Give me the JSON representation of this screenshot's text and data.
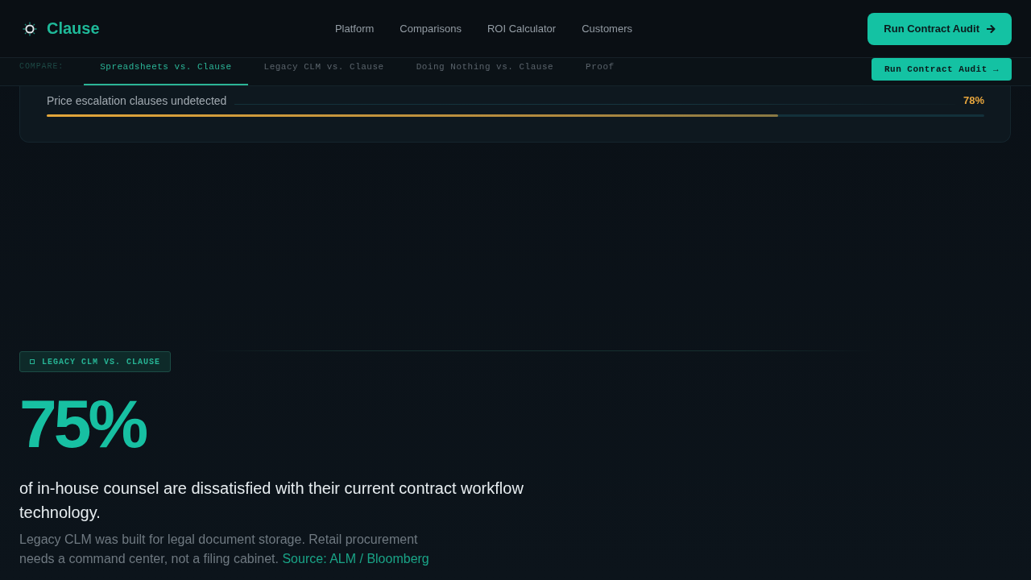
{
  "header": {
    "brand": "Clause",
    "nav": [
      "Platform",
      "Comparisons",
      "ROI Calculator",
      "Customers"
    ],
    "cta": "Run Contract Audit"
  },
  "compare_bar": {
    "label": "COMPARE:",
    "tabs": [
      {
        "label": "Spreadsheets vs. Clause",
        "selected": true
      },
      {
        "label": "Legacy CLM vs. Clause",
        "selected": false
      },
      {
        "label": "Doing Nothing vs. Clause",
        "selected": false
      },
      {
        "label": "Proof",
        "selected": false
      }
    ],
    "cta": "Run Contract Audit →"
  },
  "risk_card": {
    "rows": [
      {
        "label": "Price escalation clauses undetected",
        "reading": "78%",
        "level": 0.78
      }
    ]
  },
  "stat_section": {
    "badge": "LEGACY CLM VS. CLAUSE",
    "figure": "75%",
    "headline": "of in-house counsel are dissatisfied with their current contract workflow technology.",
    "body": "Legacy CLM was built for legal document storage. Retail procurement needs a command center, not a filing cabinet.",
    "source_link": "Source: ALM / Bloomberg"
  }
}
